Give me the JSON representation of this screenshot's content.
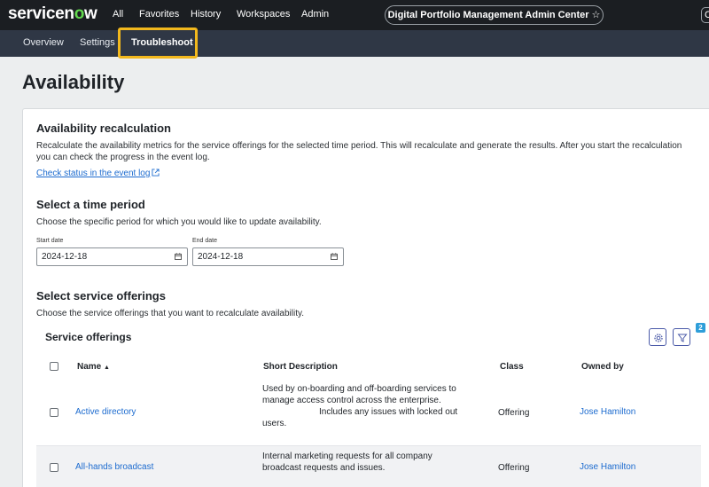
{
  "topnav": {
    "logo_pre": "servicen",
    "logo_o": "o",
    "logo_post": "w",
    "links": [
      "All",
      "Favorites",
      "History",
      "Workspaces",
      "Admin"
    ],
    "center_title": "Digital Portfolio Management Admin Center",
    "star": "☆",
    "right_fragment": "C"
  },
  "subnav": {
    "tabs": [
      "Overview",
      "Settings",
      "Troubleshoot"
    ],
    "active_tab": "Troubleshoot"
  },
  "page": {
    "title": "Availability"
  },
  "recalc": {
    "heading": "Availability recalculation",
    "description_line1": "Recalculate the availability metrics for the service offerings for the selected time period. This will recalculate and generate the results. After you start the recalculation",
    "description_line2": "you can check the progress in the event log.",
    "event_log_link": "Check status in the event log"
  },
  "time_period": {
    "heading": "Select a time period",
    "description": "Choose the specific period for which you would like to update availability.",
    "start_label": "Start date",
    "start_value": "2024-12-18",
    "end_label": "End date",
    "end_value": "2024-12-18"
  },
  "offerings": {
    "heading": "Select service offerings",
    "description": "Choose the service offerings that you want to recalculate availability.",
    "list_title": "Service offerings",
    "filter_count": "2",
    "columns": {
      "name": "Name",
      "sort_indicator": "▲",
      "short_description": "Short Description",
      "class": "Class",
      "owned_by": "Owned by"
    },
    "rows": [
      {
        "name": "Active directory",
        "desc_lines": [
          "Used by on-boarding and off-boarding services to",
          "manage access control across the enterprise.",
          "Includes any issues with locked out",
          "users."
        ],
        "class": "Offering",
        "owner": "Jose Hamilton"
      },
      {
        "name": "All-hands broadcast",
        "desc_lines": [
          "Internal marketing requests for all company",
          "broadcast requests and issues."
        ],
        "class": "Offering",
        "owner": "Jose Hamilton"
      }
    ]
  },
  "colors": {
    "topnav_bg": "#1b1e22",
    "subnav_bg": "#2f3745",
    "highlight": "#f2b81d",
    "link": "#1c6bcf",
    "logo_accent": "#62d84e",
    "badge": "#2e9ed9"
  }
}
